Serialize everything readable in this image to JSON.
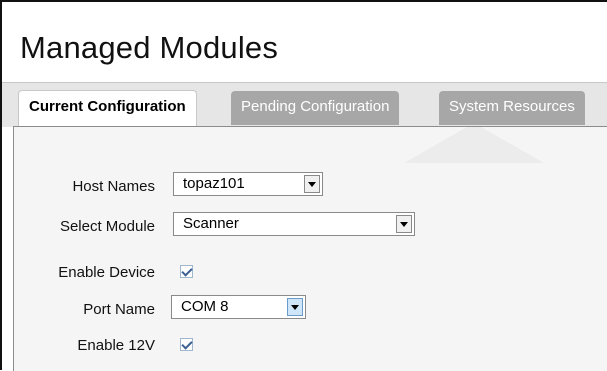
{
  "page": {
    "title": "Managed Modules"
  },
  "tabs": [
    {
      "label": "Current Configuration",
      "active": true
    },
    {
      "label": "Pending Configuration",
      "active": false
    },
    {
      "label": "System Resources",
      "active": false
    }
  ],
  "form": {
    "host_names": {
      "label": "Host Names",
      "value": "topaz101"
    },
    "select_module": {
      "label": "Select Module",
      "value": "Scanner"
    },
    "enable_device": {
      "label": "Enable Device",
      "checked": true
    },
    "port_name": {
      "label": "Port Name",
      "value": "COM 8"
    },
    "enable_12v": {
      "label": "Enable 12V",
      "checked": true
    }
  },
  "colors": {
    "tab_inactive": "#a7a7a7",
    "panel_bg": "#f5f5f5",
    "check_mark": "#3c5f94"
  }
}
